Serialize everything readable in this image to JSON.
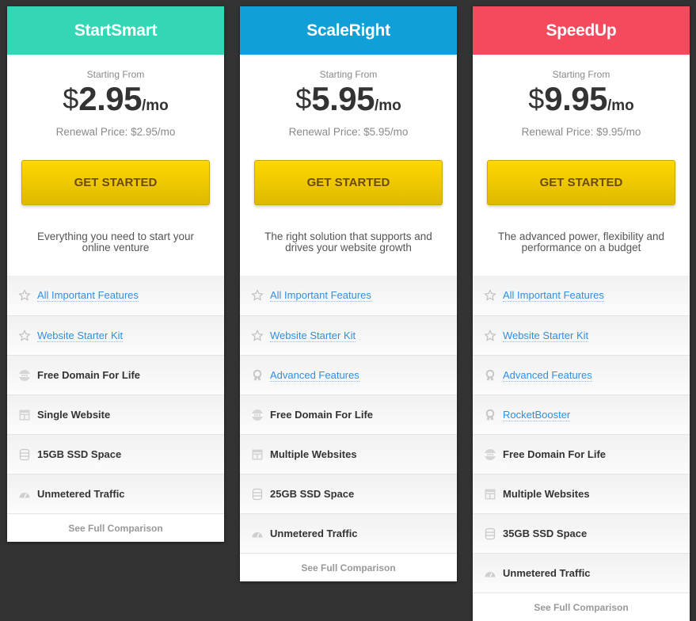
{
  "plans": [
    {
      "name": "StartSmart",
      "color": "#33d6b5",
      "starting_label": "Starting From",
      "currency": "$",
      "amount": "2.95",
      "period": "/mo",
      "renewal": "Renewal Price: $2.95/mo",
      "cta": "GET STARTED",
      "description": "Everything you need to start your online venture",
      "features": [
        {
          "icon": "star-icon",
          "label": "All Important Features",
          "link": true
        },
        {
          "icon": "star-icon",
          "label": "Website Starter Kit",
          "link": true
        },
        {
          "icon": "globe-www-icon",
          "label": "Free Domain For Life",
          "link": false
        },
        {
          "icon": "website-layout-icon",
          "label": "Single Website",
          "link": false
        },
        {
          "icon": "database-icon",
          "label": "15GB SSD Space",
          "link": false
        },
        {
          "icon": "speedometer-icon",
          "label": "Unmetered Traffic",
          "link": false
        }
      ],
      "comparison": "See Full Comparison"
    },
    {
      "name": "ScaleRight",
      "color": "#119fd8",
      "starting_label": "Starting From",
      "currency": "$",
      "amount": "5.95",
      "period": "/mo",
      "renewal": "Renewal Price: $5.95/mo",
      "cta": "GET STARTED",
      "description": "The right solution that supports and drives your website growth",
      "features": [
        {
          "icon": "star-icon",
          "label": "All Important Features",
          "link": true
        },
        {
          "icon": "star-icon",
          "label": "Website Starter Kit",
          "link": true
        },
        {
          "icon": "award-ribbon-icon",
          "label": "Advanced Features",
          "link": true
        },
        {
          "icon": "globe-www-icon",
          "label": "Free Domain For Life",
          "link": false
        },
        {
          "icon": "website-layout-icon",
          "label": "Multiple Websites",
          "link": false
        },
        {
          "icon": "database-icon",
          "label": "25GB SSD Space",
          "link": false
        },
        {
          "icon": "speedometer-icon",
          "label": "Unmetered Traffic",
          "link": false
        }
      ],
      "comparison": "See Full Comparison"
    },
    {
      "name": "SpeedUp",
      "color": "#f54a5e",
      "starting_label": "Starting From",
      "currency": "$",
      "amount": "9.95",
      "period": "/mo",
      "renewal": "Renewal Price: $9.95/mo",
      "cta": "GET STARTED",
      "description": "The advanced power, flexibility and performance on a budget",
      "features": [
        {
          "icon": "star-icon",
          "label": "All Important Features",
          "link": true
        },
        {
          "icon": "star-icon",
          "label": "Website Starter Kit",
          "link": true
        },
        {
          "icon": "award-ribbon-icon",
          "label": "Advanced Features",
          "link": true
        },
        {
          "icon": "award-ribbon-icon",
          "label": "RocketBooster",
          "link": true
        },
        {
          "icon": "globe-www-icon",
          "label": "Free Domain For Life",
          "link": false
        },
        {
          "icon": "website-layout-icon",
          "label": "Multiple Websites",
          "link": false
        },
        {
          "icon": "database-icon",
          "label": "35GB SSD Space",
          "link": false
        },
        {
          "icon": "speedometer-icon",
          "label": "Unmetered Traffic",
          "link": false
        }
      ],
      "comparison": "See Full Comparison"
    }
  ]
}
